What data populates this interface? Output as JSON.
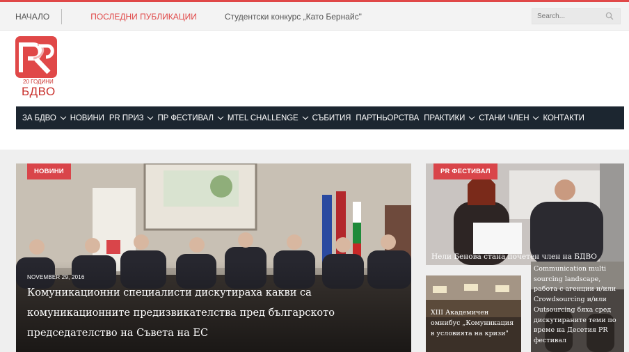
{
  "topbar": {
    "items": [
      {
        "label": "НАЧАЛО"
      },
      {
        "label": "ПОСЛЕДНИ ПУБЛИКАЦИИ"
      },
      {
        "label": "Студентски конкурс „Като Бернайс\""
      }
    ],
    "search_placeholder": "Search..."
  },
  "logo": {
    "letters": "PR",
    "years": "20 ГОДИНИ",
    "org": "БДВО"
  },
  "mainnav": [
    {
      "label": "ЗА БДВО",
      "dropdown": true
    },
    {
      "label": "НОВИНИ",
      "dropdown": false
    },
    {
      "label": "PR ПРИЗ",
      "dropdown": true
    },
    {
      "label": "ПР ФЕСТИВАЛ",
      "dropdown": true
    },
    {
      "label": "MTEL CHALLENGE",
      "dropdown": true
    },
    {
      "label": "СЪБИТИЯ",
      "dropdown": false
    },
    {
      "label": "ПАРТНЬОРСТВА",
      "dropdown": false
    },
    {
      "label": "ПРАКТИКИ",
      "dropdown": true
    },
    {
      "label": "СТАНИ ЧЛЕН",
      "dropdown": true
    },
    {
      "label": "КОНТАКТИ",
      "dropdown": false
    }
  ],
  "featured": {
    "category": "НОВИНИ",
    "date": "NOVEMBER 29, 2016",
    "headline": "Комуникационни специалисти дискутираха какви са комуникационните предизвикателства пред българското председателство на Съвета на ЕС"
  },
  "cards": [
    {
      "category": "PR ФЕСТИВАЛ",
      "title": "Нели Бенова стана почетен член на БДВО"
    },
    {
      "title": "XIII Академичен омнибус „Комуникация в условията на кризи\""
    },
    {
      "title": "Communication multi sourcing landscape, работа с агенции и/или Crowdsourcing и/или Outsourcing бяха сред дискутираните теми по време на Десетия PR фестивал"
    }
  ],
  "colors": {
    "accent": "#e04848",
    "nav_bg": "#1c2630",
    "tag_bg": "#d9454a",
    "logo": "#c9302c"
  },
  "icons": [
    "search-icon",
    "chevron-down-icon",
    "pr-logo-icon"
  ]
}
